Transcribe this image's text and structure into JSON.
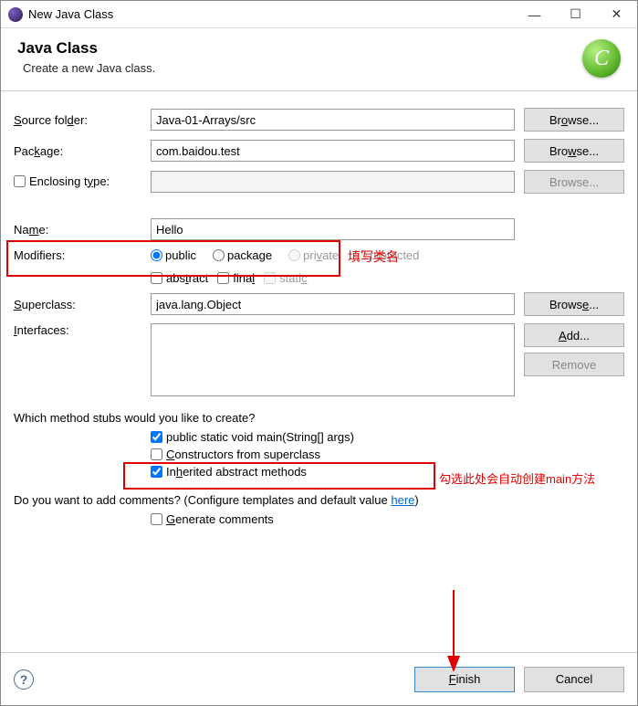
{
  "titlebar": {
    "title": "New Java Class"
  },
  "header": {
    "title": "Java Class",
    "subtitle": "Create a new Java class."
  },
  "labels": {
    "source_folder": "Source folder:",
    "package": "Package:",
    "enclosing_type": "Enclosing type:",
    "name": "Name:",
    "modifiers": "Modifiers:",
    "superclass": "Superclass:",
    "interfaces": "Interfaces:"
  },
  "fields": {
    "source_folder": "Java-01-Arrays/src",
    "package": "com.baidou.test",
    "enclosing_type": "",
    "name": "Hello",
    "superclass": "java.lang.Object"
  },
  "buttons": {
    "browse": "Browse...",
    "add": "Add...",
    "remove": "Remove",
    "finish": "Finish",
    "cancel": "Cancel"
  },
  "modifiers": {
    "public": "public",
    "package": "package",
    "private": "private",
    "protected": "protected",
    "abstract": "abstract",
    "final": "final",
    "static": "static",
    "selected": "public"
  },
  "stubs": {
    "question": "Which method stubs would you like to create?",
    "main": "public static void main(String[] args)",
    "constructors": "Constructors from superclass",
    "inherited": "Inherited abstract methods",
    "main_checked": true,
    "constructors_checked": false,
    "inherited_checked": true
  },
  "comments": {
    "question_prefix": "Do you want to add comments? (Configure templates and default value ",
    "link": "here",
    "question_suffix": ")",
    "generate": "Generate comments",
    "generate_checked": false
  },
  "annotations": {
    "name_hint": "填写类名",
    "main_hint": "勾选此处会自动创建main方法"
  }
}
